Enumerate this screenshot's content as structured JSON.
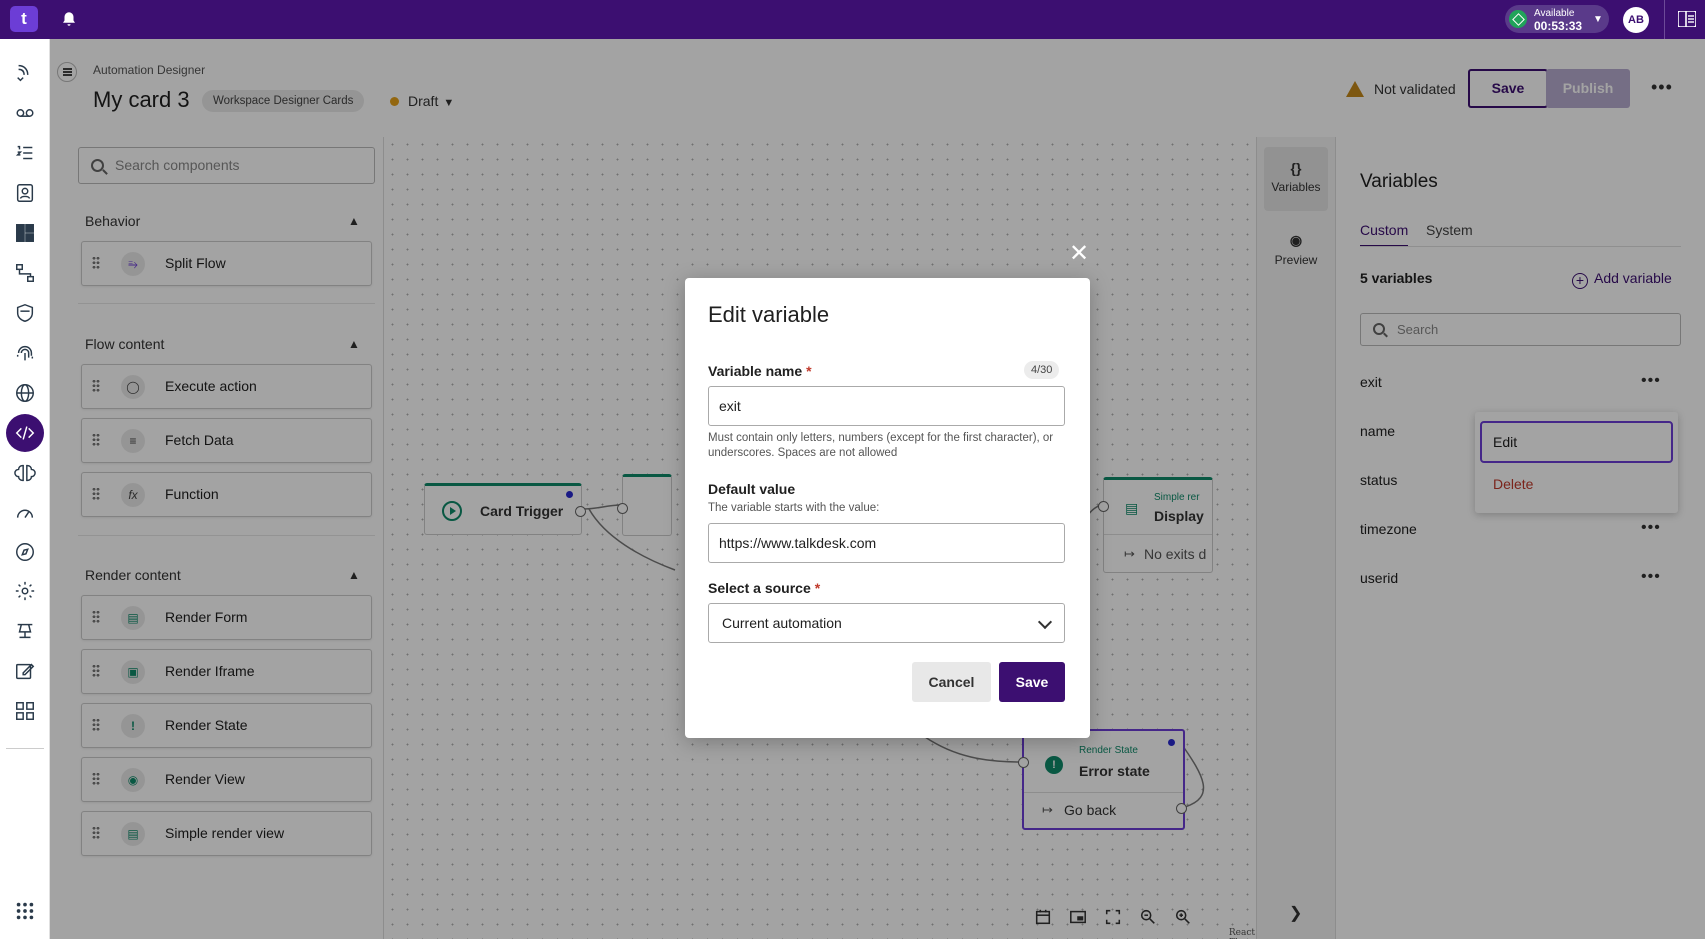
{
  "topbar": {
    "logo": "t",
    "status_label": "Available",
    "status_time": "00:53:33",
    "avatar_initials": "AB"
  },
  "header": {
    "breadcrumb": "Automation Designer",
    "title": "My card 3",
    "workspace_badge": "Workspace Designer Cards",
    "draft_label": "Draft",
    "validation_status": "Not validated",
    "save_label": "Save",
    "publish_label": "Publish"
  },
  "components": {
    "search_placeholder": "Search components",
    "sections": [
      {
        "title": "Behavior",
        "items": [
          {
            "label": "Split Flow",
            "icon": "split-icon"
          }
        ]
      },
      {
        "title": "Flow content",
        "items": [
          {
            "label": "Execute action",
            "icon": "globe-icon"
          },
          {
            "label": "Fetch Data",
            "icon": "search-list-icon"
          },
          {
            "label": "Function",
            "icon": "function-icon"
          }
        ]
      },
      {
        "title": "Render content",
        "items": [
          {
            "label": "Render Form",
            "icon": "form-icon"
          },
          {
            "label": "Render Iframe",
            "icon": "iframe-icon"
          },
          {
            "label": "Render State",
            "icon": "alert-icon"
          },
          {
            "label": "Render View",
            "icon": "eye-icon"
          },
          {
            "label": "Simple render view",
            "icon": "document-icon"
          }
        ]
      }
    ]
  },
  "canvas": {
    "trigger_node": "Card Trigger",
    "display_node_type": "Simple rer",
    "display_node_title": "Display",
    "display_node_exits": "No exits d",
    "error_node_type": "Render State",
    "error_node_title": "Error state",
    "error_node_exit": "Go back",
    "attribution": "React Flow"
  },
  "rail": {
    "variables_label": "Variables",
    "preview_label": "Preview"
  },
  "variables_panel": {
    "title": "Variables",
    "tabs": [
      "Custom",
      "System"
    ],
    "count_label": "5 variables",
    "add_label": "Add variable",
    "search_placeholder": "Search",
    "rows": [
      "exit",
      "name",
      "status",
      "timezone",
      "userid"
    ],
    "context_menu": {
      "edit": "Edit",
      "delete": "Delete"
    }
  },
  "modal": {
    "title": "Edit variable",
    "name_label": "Variable name",
    "name_counter": "4/30",
    "name_value": "exit",
    "name_help": "Must contain only letters, numbers (except for the first character), or underscores. Spaces are not allowed",
    "default_label": "Default value",
    "default_help": "The variable starts with the value:",
    "default_value": "https://www.talkdesk.com",
    "source_label": "Select a source",
    "source_value": "Current automation",
    "cancel_label": "Cancel",
    "save_label": "Save"
  },
  "colors": {
    "brand": "#3c0f71",
    "accent": "#6c3dd6",
    "status_green": "#20a35a",
    "teal": "#0f8a6a",
    "danger": "#c0392b"
  }
}
